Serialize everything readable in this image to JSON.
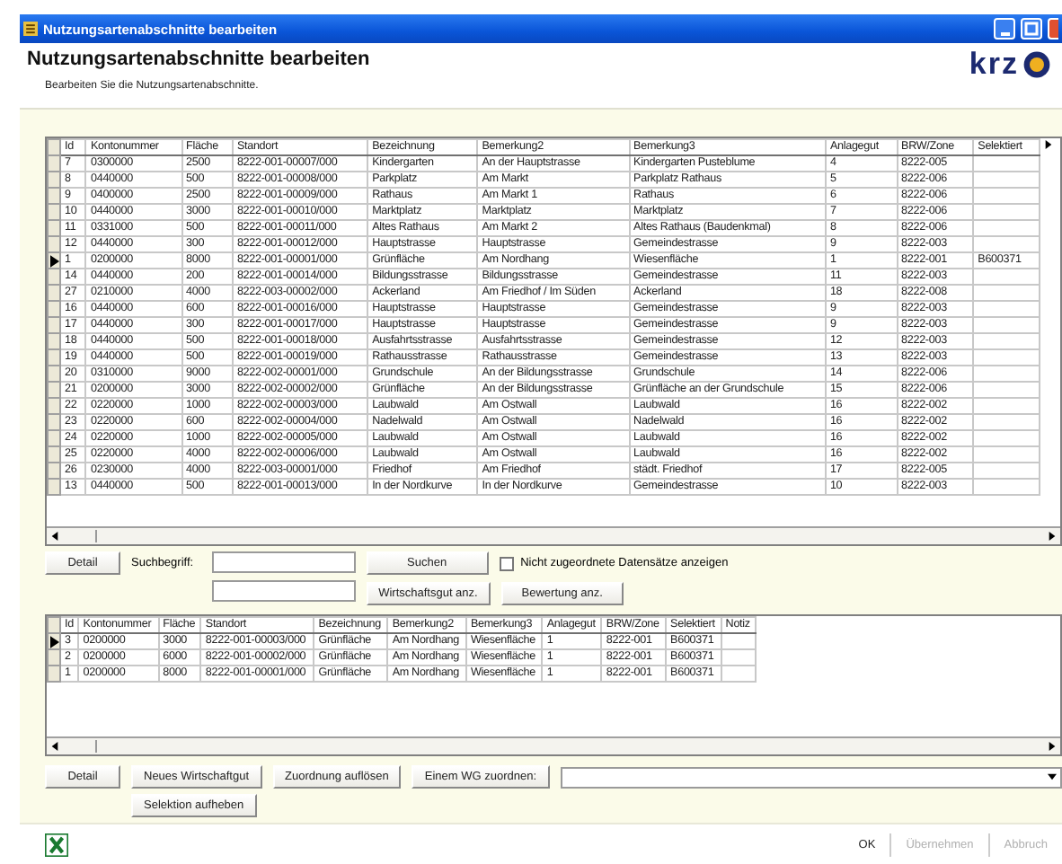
{
  "window": {
    "title": "Nutzungsartenabschnitte bearbeiten"
  },
  "header": {
    "title": "Nutzungsartenabschnitte bearbeiten",
    "subtitle": "Bearbeiten Sie die Nutzungsartenabschnitte.",
    "logo": "krz"
  },
  "top_table": {
    "columns": [
      "Id",
      "Kontonummer",
      "Fläche",
      "Standort",
      "Bezeichnung",
      "Bemerkung2",
      "Bemerkung3",
      "Anlagegut",
      "BRW/Zone",
      "Selektiert"
    ],
    "rows": [
      {
        "selected": false,
        "cells": [
          "7",
          "0300000",
          "2500",
          "8222-001-00007/000",
          "Kindergarten",
          "An der Hauptstrasse",
          "Kindergarten Pusteblume",
          "4",
          "8222-005"
        ]
      },
      {
        "selected": false,
        "cells": [
          "8",
          "0440000",
          "500",
          "8222-001-00008/000",
          "Parkplatz",
          "Am Markt",
          "Parkplatz Rathaus",
          "5",
          "8222-006"
        ]
      },
      {
        "selected": false,
        "cells": [
          "9",
          "0400000",
          "2500",
          "8222-001-00009/000",
          "Rathaus",
          "Am Markt 1",
          "Rathaus",
          "6",
          "8222-006"
        ]
      },
      {
        "selected": false,
        "cells": [
          "10",
          "0440000",
          "3000",
          "8222-001-00010/000",
          "Marktplatz",
          "Marktplatz",
          "Marktplatz",
          "7",
          "8222-006"
        ]
      },
      {
        "selected": false,
        "cells": [
          "11",
          "0331000",
          "500",
          "8222-001-00011/000",
          "Altes Rathaus",
          "Am Markt 2",
          "Altes Rathaus (Baudenkmal)",
          "8",
          "8222-006"
        ]
      },
      {
        "selected": false,
        "cells": [
          "12",
          "0440000",
          "300",
          "8222-001-00012/000",
          "Hauptstrasse",
          "Hauptstrasse",
          "Gemeindestrasse",
          "9",
          "8222-003"
        ]
      },
      {
        "selected": true,
        "cells": [
          "1",
          "0200000",
          "8000",
          "8222-001-00001/000",
          "Grünfläche",
          "Am Nordhang",
          "Wiesenfläche",
          "1",
          "8222-001",
          "B600371"
        ]
      },
      {
        "selected": false,
        "cells": [
          "14",
          "0440000",
          "200",
          "8222-001-00014/000",
          "Bildungsstrasse",
          "Bildungsstrasse",
          "Gemeindestrasse",
          "11",
          "8222-003"
        ]
      },
      {
        "selected": false,
        "cells": [
          "27",
          "0210000",
          "4000",
          "8222-003-00002/000",
          "Ackerland",
          "Am Friedhof / Im Süden",
          "Ackerland",
          "18",
          "8222-008"
        ]
      },
      {
        "selected": false,
        "cells": [
          "16",
          "0440000",
          "600",
          "8222-001-00016/000",
          "Hauptstrasse",
          "Hauptstrasse",
          "Gemeindestrasse",
          "9",
          "8222-003"
        ]
      },
      {
        "selected": false,
        "cells": [
          "17",
          "0440000",
          "300",
          "8222-001-00017/000",
          "Hauptstrasse",
          "Hauptstrasse",
          "Gemeindestrasse",
          "9",
          "8222-003"
        ]
      },
      {
        "selected": false,
        "cells": [
          "18",
          "0440000",
          "500",
          "8222-001-00018/000",
          "Ausfahrtsstrasse",
          "Ausfahrtsstrasse",
          "Gemeindestrasse",
          "12",
          "8222-003"
        ]
      },
      {
        "selected": false,
        "cells": [
          "19",
          "0440000",
          "500",
          "8222-001-00019/000",
          "Rathausstrasse",
          "Rathausstrasse",
          "Gemeindestrasse",
          "13",
          "8222-003"
        ]
      },
      {
        "selected": false,
        "cells": [
          "20",
          "0310000",
          "9000",
          "8222-002-00001/000",
          "Grundschule",
          "An der Bildungsstrasse",
          "Grundschule",
          "14",
          "8222-006"
        ]
      },
      {
        "selected": false,
        "cells": [
          "21",
          "0200000",
          "3000",
          "8222-002-00002/000",
          "Grünfläche",
          "An der Bildungsstrasse",
          "Grünfläche an der Grundschule",
          "15",
          "8222-006"
        ]
      },
      {
        "selected": false,
        "cells": [
          "22",
          "0220000",
          "1000",
          "8222-002-00003/000",
          "Laubwald",
          "Am Ostwall",
          "Laubwald",
          "16",
          "8222-002"
        ]
      },
      {
        "selected": false,
        "cells": [
          "23",
          "0220000",
          "600",
          "8222-002-00004/000",
          "Nadelwald",
          "Am Ostwall",
          "Nadelwald",
          "16",
          "8222-002"
        ]
      },
      {
        "selected": false,
        "cells": [
          "24",
          "0220000",
          "1000",
          "8222-002-00005/000",
          "Laubwald",
          "Am Ostwall",
          "Laubwald",
          "16",
          "8222-002"
        ]
      },
      {
        "selected": false,
        "cells": [
          "25",
          "0220000",
          "4000",
          "8222-002-00006/000",
          "Laubwald",
          "Am Ostwall",
          "Laubwald",
          "16",
          "8222-002"
        ]
      },
      {
        "selected": false,
        "cells": [
          "26",
          "0230000",
          "4000",
          "8222-003-00001/000",
          "Friedhof",
          "Am Friedhof",
          "städt. Friedhof",
          "17",
          "8222-005"
        ]
      },
      {
        "selected": false,
        "cells": [
          "13",
          "0440000",
          "500",
          "8222-001-00013/000",
          "In der Nordkurve",
          "In der Nordkurve",
          "Gemeindestrasse",
          "10",
          "8222-003"
        ]
      }
    ]
  },
  "search_bar": {
    "detail_button": "Detail",
    "search_label": "Suchbegriff:",
    "search_button": "Suchen",
    "checkbox": {
      "label": "Nicht zugeordnete Datensätze anzeigen",
      "checked": false
    },
    "buttons": [
      "Wirtschaftsgut anz.",
      "Bewertung anz."
    ]
  },
  "bottom_table": {
    "columns": [
      "Id",
      "Kontonummer",
      "Fläche",
      "Standort",
      "Bezeichnung",
      "Bemerkung2",
      "Bemerkung3",
      "Anlagegut",
      "BRW/Zone",
      "Selektiert",
      "Notiz"
    ],
    "rows": [
      {
        "selected": true,
        "cells": [
          "3",
          "0200000",
          "3000",
          "8222-001-00003/000",
          "Grünfläche",
          "Am Nordhang",
          "Wiesenfläche",
          "1",
          "8222-001",
          "B600371"
        ]
      },
      {
        "selected": false,
        "cells": [
          "2",
          "0200000",
          "6000",
          "8222-001-00002/000",
          "Grünfläche",
          "Am Nordhang",
          "Wiesenfläche",
          "1",
          "8222-001",
          "B600371"
        ]
      },
      {
        "selected": false,
        "cells": [
          "1",
          "0200000",
          "8000",
          "8222-001-00001/000",
          "Grünfläche",
          "Am Nordhang",
          "Wiesenfläche",
          "1",
          "8222-001",
          "B600371"
        ]
      }
    ]
  },
  "action_buttons": [
    "Detail",
    "Neues Wirtschaftgut",
    "Zuordnung auflösen",
    "Einem WG zuordnen:"
  ],
  "selection_button": "Selektion aufheben",
  "footer": {
    "buttons": [
      {
        "label": "OK",
        "disabled": false
      },
      {
        "label": "Übernehmen",
        "disabled": true
      },
      {
        "label": "Abbruch",
        "disabled": true
      }
    ]
  }
}
